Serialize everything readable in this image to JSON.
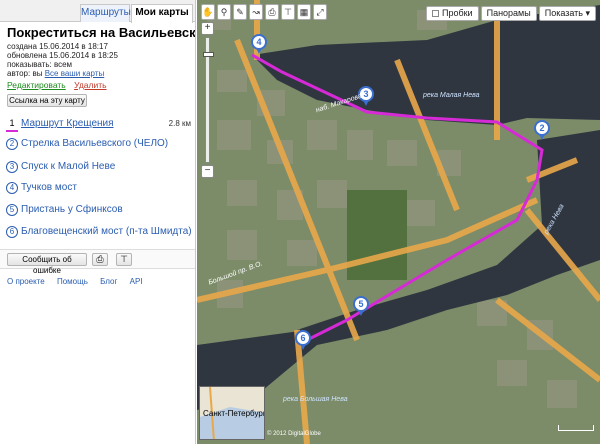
{
  "tabs": {
    "routes": "Маршруты",
    "my_maps": "Мои карты"
  },
  "map_title": "Покреститься на Васильевском",
  "meta": {
    "created": "создана 15.06.2014 в 18:17",
    "updated": "обновлена 15.06.2014 в 18:25",
    "visibility": "показывать: всем",
    "author_prefix": "автор: вы",
    "author_link": "Все ваши карты"
  },
  "actions": {
    "edit": "Редактировать",
    "delete": "Удалить"
  },
  "link_button": "Ссылка на эту карту",
  "route_items": [
    {
      "num": "1",
      "label": "Маршрут Крещения",
      "length": "2.8 км"
    },
    {
      "num": "2",
      "label": "Стрелка Васильевского (ЧЕЛО)"
    },
    {
      "num": "3",
      "label": "Спуск к Малой Неве"
    },
    {
      "num": "4",
      "label": "Тучков мост"
    },
    {
      "num": "5",
      "label": "Пристань у Сфинксов"
    },
    {
      "num": "6",
      "label": "Благовещенский мост (п-та Шмидта)"
    }
  ],
  "report_button": "Сообщить об ошибке",
  "print_icon": "printer-icon",
  "embed_icon": "embed-icon",
  "footer": {
    "about": "О проекте",
    "help": "Помощь",
    "blog": "Блог",
    "api": "API"
  },
  "map_toolbar": {
    "hand": "hand-icon",
    "magnifier": "magnifier-icon",
    "ruler": "ruler-icon",
    "route": "route-icon",
    "print": "printer-icon",
    "embed": "embed-icon",
    "layers": "layers-icon",
    "fullscreen": "fullscreen-icon"
  },
  "layer_buttons": {
    "traffic": "Пробки",
    "panoramas": "Панорамы",
    "show": "Показать ▾"
  },
  "markers": [
    "2",
    "3",
    "4",
    "5",
    "6"
  ],
  "river_labels": {
    "malaya_neva": "река Малая Нева",
    "bolshaya_neva": "река Большая Нева",
    "neva": "река Нева"
  },
  "street_labels": {
    "makarova": "наб. Макарова",
    "bolshoy": "Большой пр. В.О.",
    "sredny": "Средний пр."
  },
  "minimap_text": "Санкт-Петербург",
  "copyright": "© 2012 DigitalGlobe",
  "colors": {
    "route": "#d62ad6",
    "marker": "#3a6fd0",
    "link": "#2a5db0",
    "edit": "#1d8a1d",
    "delete": "#c0392b"
  }
}
